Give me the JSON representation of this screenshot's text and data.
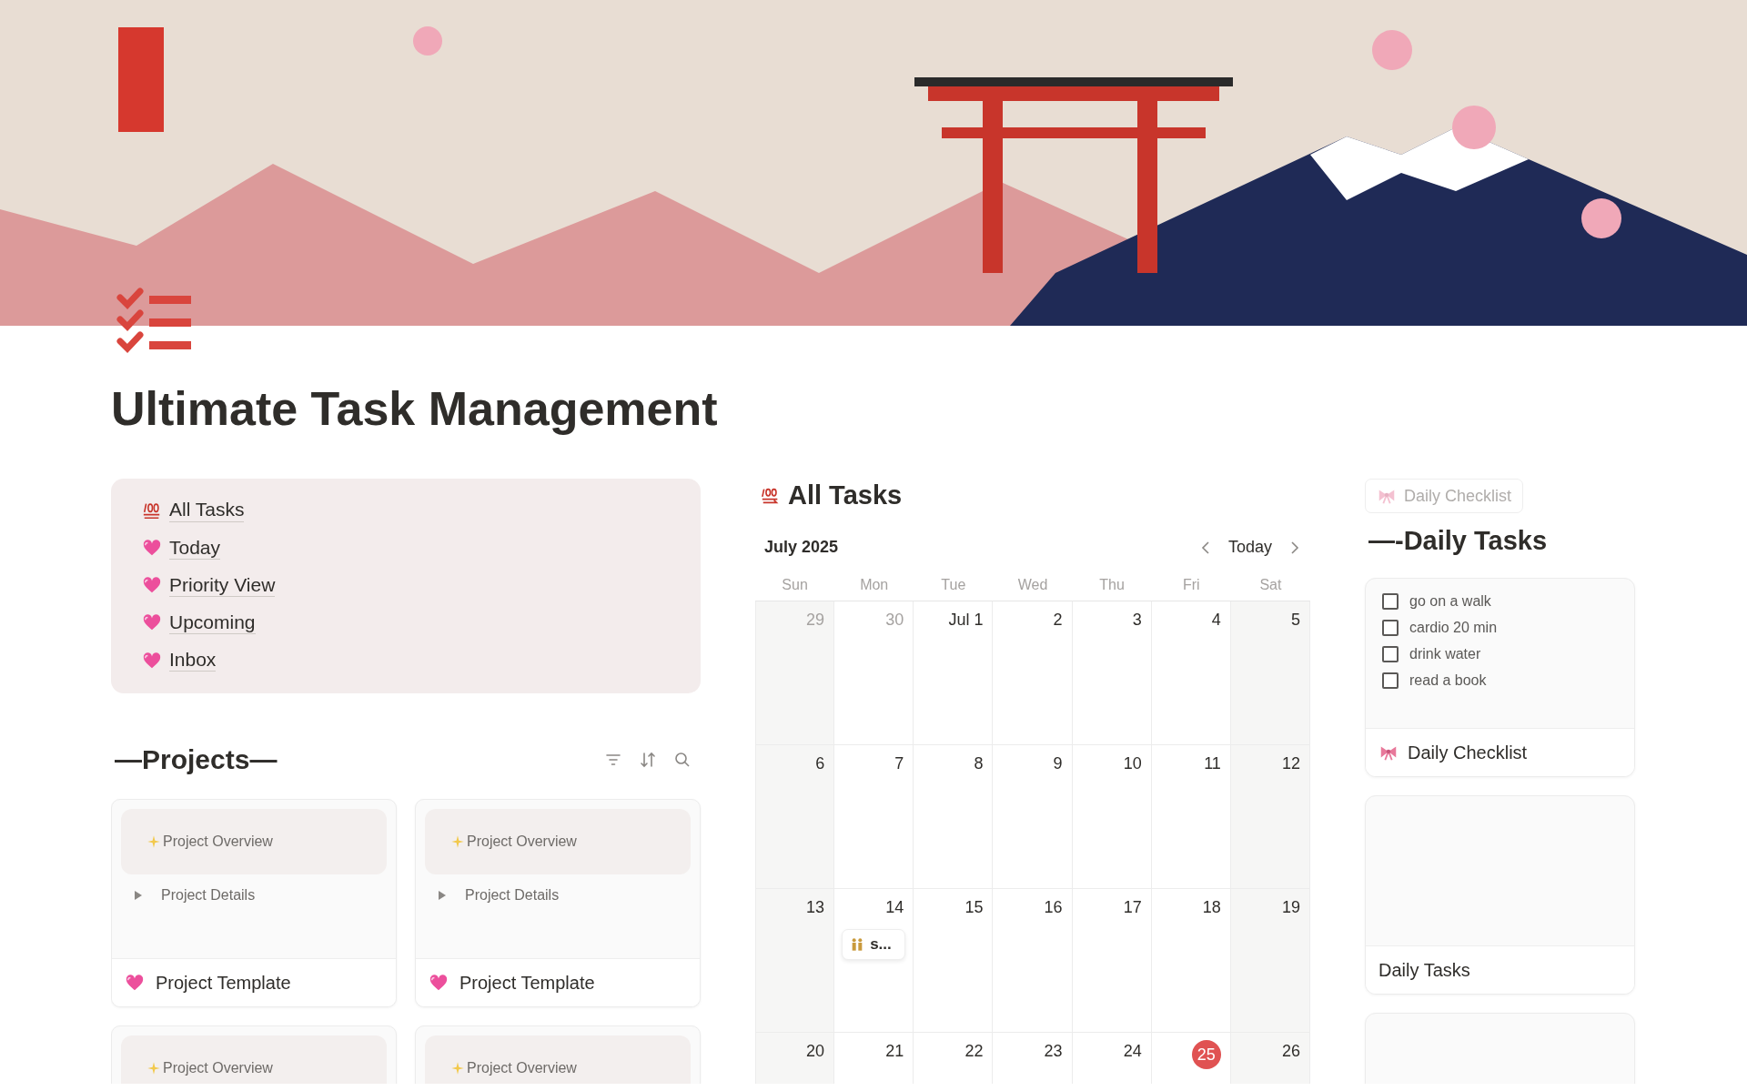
{
  "page": {
    "title": "Ultimate Task Management"
  },
  "nav_links": [
    {
      "kind": "hundred",
      "label": "All Tasks"
    },
    {
      "kind": "heart",
      "label": "Today"
    },
    {
      "kind": "heart",
      "label": "Priority View"
    },
    {
      "kind": "heart",
      "label": "Upcoming"
    },
    {
      "kind": "heart",
      "label": "Inbox"
    }
  ],
  "projects": {
    "title": "—Projects—",
    "cards": [
      {
        "overview": "Project Overview",
        "details": "Project Details",
        "expanded": false,
        "title": "Project Template"
      },
      {
        "overview": "Project Overview",
        "details": "Project Details",
        "expanded": false,
        "title": "Project Template"
      },
      {
        "overview": "Project Overview"
      },
      {
        "overview": "Project Overview"
      }
    ]
  },
  "calendar": {
    "title": "All Tasks",
    "month": "July 2025",
    "today_button": "Today",
    "weekdays": [
      "Sun",
      "Mon",
      "Tue",
      "Wed",
      "Thu",
      "Fri",
      "Sat"
    ],
    "weeks": [
      [
        {
          "label": "29",
          "muted": true,
          "today": false
        },
        {
          "label": "30",
          "muted": true,
          "today": false
        },
        {
          "label": "Jul 1",
          "muted": false,
          "today": false
        },
        {
          "label": "2",
          "muted": false,
          "today": false
        },
        {
          "label": "3",
          "muted": false,
          "today": false
        },
        {
          "label": "4",
          "muted": false,
          "today": false
        },
        {
          "label": "5",
          "muted": false,
          "today": false
        }
      ],
      [
        {
          "label": "6",
          "muted": false,
          "today": false
        },
        {
          "label": "7",
          "muted": false,
          "today": false
        },
        {
          "label": "8",
          "muted": false,
          "today": false
        },
        {
          "label": "9",
          "muted": false,
          "today": false
        },
        {
          "label": "10",
          "muted": false,
          "today": false
        },
        {
          "label": "11",
          "muted": false,
          "today": false
        },
        {
          "label": "12",
          "muted": false,
          "today": false
        }
      ],
      [
        {
          "label": "13",
          "muted": false,
          "today": false
        },
        {
          "label": "14",
          "muted": false,
          "today": false,
          "events": [
            "s..."
          ]
        },
        {
          "label": "15",
          "muted": false,
          "today": false
        },
        {
          "label": "16",
          "muted": false,
          "today": false
        },
        {
          "label": "17",
          "muted": false,
          "today": false
        },
        {
          "label": "18",
          "muted": false,
          "today": false
        },
        {
          "label": "19",
          "muted": false,
          "today": false
        }
      ],
      [
        {
          "label": "20",
          "muted": false,
          "today": false
        },
        {
          "label": "21",
          "muted": false,
          "today": false
        },
        {
          "label": "22",
          "muted": false,
          "today": false
        },
        {
          "label": "23",
          "muted": false,
          "today": false
        },
        {
          "label": "24",
          "muted": false,
          "today": false
        },
        {
          "label": "25",
          "muted": false,
          "today": true
        },
        {
          "label": "26",
          "muted": false,
          "today": false
        }
      ]
    ]
  },
  "daily": {
    "button": "Daily Checklist",
    "title": "—-Daily Tasks",
    "cards": [
      {
        "kind": "checklist",
        "items": [
          {
            "label": "go on a walk",
            "checked": false
          },
          {
            "label": "cardio 20 min",
            "checked": false
          },
          {
            "label": "drink water",
            "checked": false
          },
          {
            "label": "read a book",
            "checked": false
          }
        ],
        "title": "Daily Checklist"
      },
      {
        "kind": "blank",
        "title": "Daily Tasks"
      },
      {
        "kind": "blank"
      }
    ]
  }
}
